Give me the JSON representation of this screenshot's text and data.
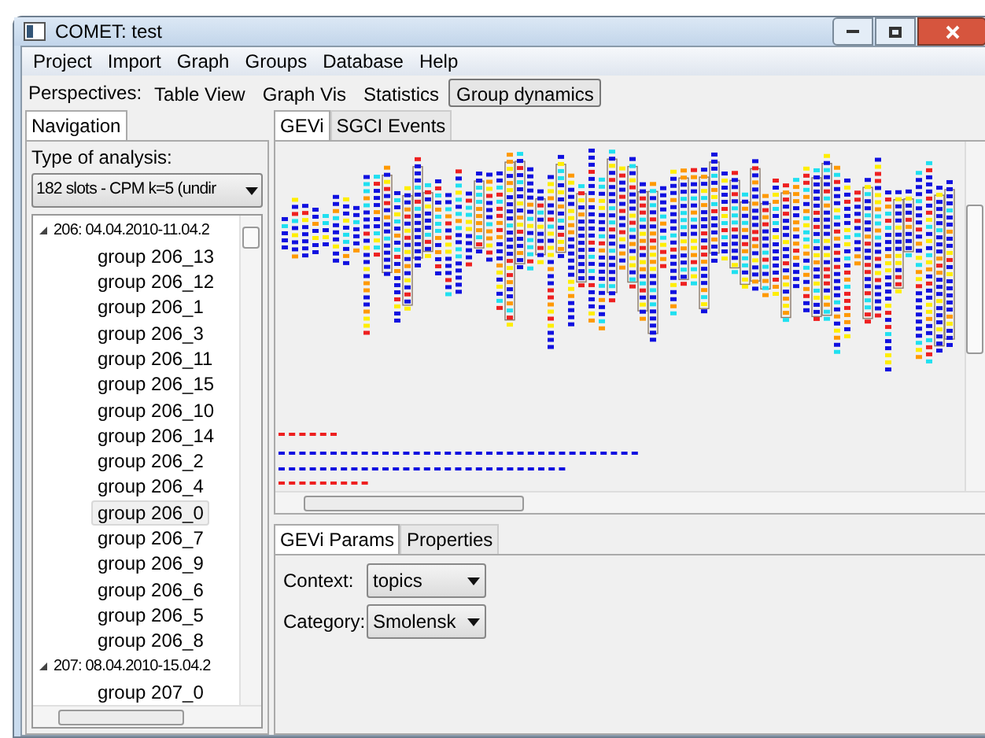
{
  "window": {
    "title": "COMET: test"
  },
  "menu": [
    "Project",
    "Import",
    "Graph",
    "Groups",
    "Database",
    "Help"
  ],
  "perspectives": {
    "label": "Perspectives:",
    "items": [
      {
        "label": "Table View",
        "selected": false
      },
      {
        "label": "Graph Vis",
        "selected": false
      },
      {
        "label": "Statistics",
        "selected": false
      },
      {
        "label": "Group dynamics",
        "selected": true
      }
    ]
  },
  "navigation": {
    "tabs": [
      {
        "label": "Navigation",
        "selected": true
      }
    ],
    "analysis_label": "Type of analysis:",
    "analysis_value": "182 slots - CPM k=5 (undir",
    "tree": [
      {
        "label": "206: 04.04.2010-11.04.2",
        "expanded": true,
        "children": [
          {
            "label": "group 206_13",
            "selected": false
          },
          {
            "label": "group 206_12",
            "selected": false
          },
          {
            "label": "group 206_1",
            "selected": false
          },
          {
            "label": "group 206_3",
            "selected": false
          },
          {
            "label": "group 206_11",
            "selected": false
          },
          {
            "label": "group 206_15",
            "selected": false
          },
          {
            "label": "group 206_10",
            "selected": false
          },
          {
            "label": "group 206_14",
            "selected": false
          },
          {
            "label": "group 206_2",
            "selected": false
          },
          {
            "label": "group 206_4",
            "selected": false
          },
          {
            "label": "group 206_0",
            "selected": true
          },
          {
            "label": "group 206_7",
            "selected": false
          },
          {
            "label": "group 206_9",
            "selected": false
          },
          {
            "label": "group 206_6",
            "selected": false
          },
          {
            "label": "group 206_5",
            "selected": false
          },
          {
            "label": "group 206_8",
            "selected": false
          }
        ]
      },
      {
        "label": "207: 08.04.2010-15.04.2",
        "expanded": true,
        "children": [
          {
            "label": "group 207_0",
            "selected": false
          }
        ]
      }
    ]
  },
  "view_tabs": [
    {
      "label": "GEVi",
      "selected": true
    },
    {
      "label": "SGCI Events",
      "selected": false
    }
  ],
  "param_tabs": [
    {
      "label": "GEVi Params",
      "selected": true
    },
    {
      "label": "Properties",
      "selected": false
    }
  ],
  "params": [
    {
      "label": "Context:",
      "value": "topics"
    },
    {
      "label": "Category:",
      "value": "Smolensk"
    }
  ]
}
